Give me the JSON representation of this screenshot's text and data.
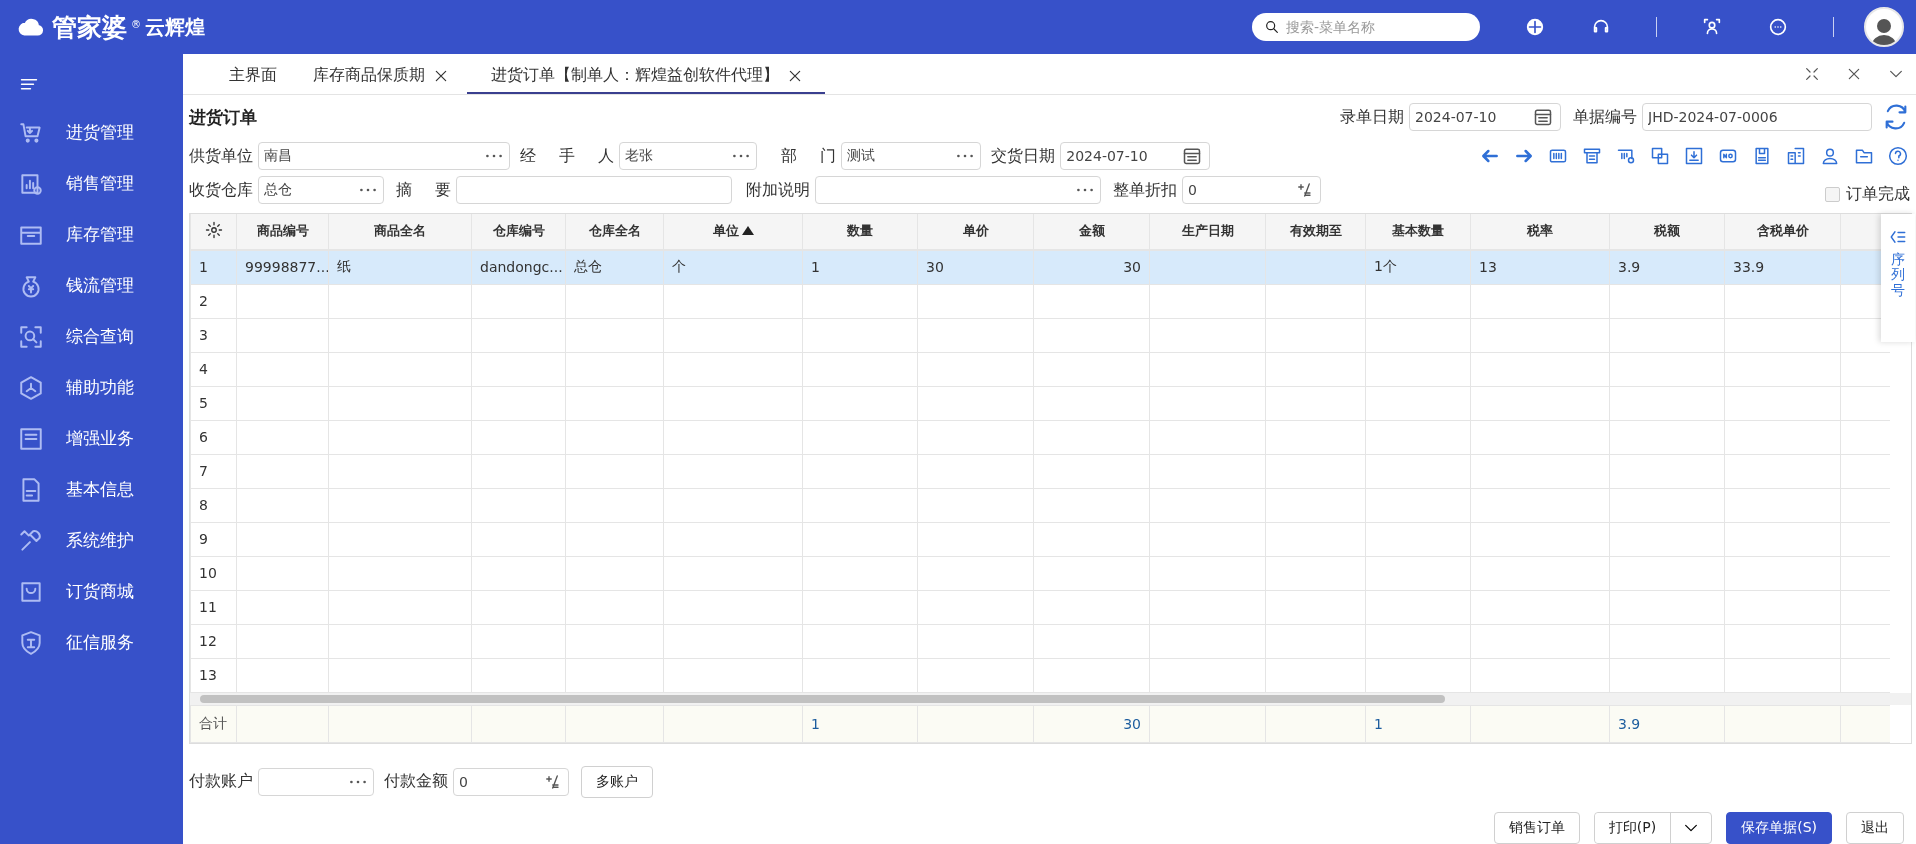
{
  "topbar": {
    "logo": "管家婆",
    "logo_mark": "®",
    "logo_sub": "云辉煌",
    "search": {
      "placeholder": "搜索-菜单名称"
    }
  },
  "sidebar": {
    "items": [
      {
        "label": "进货管理",
        "selected": false
      },
      {
        "label": "销售管理",
        "selected": false
      },
      {
        "label": "库存管理",
        "selected": false
      },
      {
        "label": "钱流管理",
        "selected": false
      },
      {
        "label": "综合查询",
        "selected": false
      },
      {
        "label": "辅助功能",
        "selected": false
      },
      {
        "label": "增强业务",
        "selected": false
      },
      {
        "label": "基本信息",
        "selected": false
      },
      {
        "label": "系统维护",
        "selected": false
      },
      {
        "label": "订货商城",
        "selected": false
      },
      {
        "label": "征信服务",
        "selected": false
      }
    ]
  },
  "tabs": [
    {
      "label": "主界面",
      "selected": false,
      "closable": false
    },
    {
      "label": "库存商品保质期",
      "selected": false,
      "closable": true
    },
    {
      "label": "进货订单【制单人：辉煌益创软件代理】",
      "selected": true,
      "closable": true
    }
  ],
  "form": {
    "title": "进货订单",
    "entry_date": {
      "label": "录单日期",
      "value": "2024-07-10"
    },
    "doc_number": {
      "label": "单据编号",
      "value": "JHD-2024-07-0006"
    },
    "row_1": [
      {
        "kind": "lookup",
        "label": "供货单位",
        "value": "南昌"
      },
      {
        "kind": "lookup",
        "label": "经 手 人",
        "value": "老张"
      },
      {
        "kind": "lookup",
        "label": "部 门",
        "value": "测试"
      },
      {
        "kind": "date",
        "label": "交货日期",
        "value": "2024-07-10"
      }
    ],
    "row_2": [
      {
        "kind": "lookup",
        "label": "收货仓库",
        "value": "总仓"
      },
      {
        "kind": "text",
        "label": "摘 要"
      },
      {
        "kind": "lookup",
        "label": "附加说明"
      },
      {
        "kind": "percent",
        "label": "整单折扣",
        "value": "0"
      }
    ],
    "order_complete": {
      "label": "订单完成",
      "checked": false
    }
  },
  "table": {
    "columns": [
      {
        "label": "商品编号",
        "sorted": false
      },
      {
        "label": "商品全名",
        "sorted": false
      },
      {
        "label": "仓库编号",
        "sorted": false
      },
      {
        "label": "仓库全名",
        "sorted": false
      },
      {
        "label": "单位",
        "sorted": true
      },
      {
        "label": "数量",
        "sorted": false
      },
      {
        "label": "单价",
        "sorted": false
      },
      {
        "label": "金额",
        "sorted": false,
        "kind": "amount"
      },
      {
        "label": "生产日期",
        "sorted": false
      },
      {
        "label": "有效期至",
        "sorted": false
      },
      {
        "label": "基本数量",
        "sorted": false
      },
      {
        "label": "税率",
        "sorted": false
      },
      {
        "label": "税额",
        "sorted": false
      },
      {
        "label": "含税单价",
        "sorted": false
      }
    ],
    "rows": [
      {
        "number": "1",
        "selected": true,
        "cells": [
          "99998877...",
          "纸",
          "dandongc...",
          "总仓",
          "个",
          "1",
          "30",
          "30",
          null,
          null,
          "1个",
          "13",
          "3.9",
          "33.9"
        ]
      },
      {
        "number": "2",
        "selected": false
      },
      {
        "number": "3",
        "selected": false
      },
      {
        "number": "4",
        "selected": false
      },
      {
        "number": "5",
        "selected": false
      },
      {
        "number": "6",
        "selected": false
      },
      {
        "number": "7",
        "selected": false
      },
      {
        "number": "8",
        "selected": false
      },
      {
        "number": "9",
        "selected": false
      },
      {
        "number": "10",
        "selected": false
      },
      {
        "number": "11",
        "selected": false
      },
      {
        "number": "12",
        "selected": false
      },
      {
        "number": "13",
        "selected": false
      }
    ],
    "totals": {
      "label": "合计",
      "cells": [
        null,
        null,
        null,
        null,
        null,
        "1",
        null,
        "30",
        null,
        null,
        "1",
        null,
        "3.9"
      ]
    },
    "side_tab": "序列号"
  },
  "payment": {
    "account": {
      "label": "付款账户"
    },
    "amount": {
      "label": "付款金额",
      "value": "0"
    },
    "multi_button": "多账户"
  },
  "buttons": [
    {
      "kind": "plain",
      "label": "销售订单"
    },
    {
      "kind": "split",
      "label": "打印(P)"
    },
    {
      "kind": "primary",
      "label": "保存单据(S)"
    },
    {
      "kind": "plain",
      "label": "退出"
    }
  ]
}
